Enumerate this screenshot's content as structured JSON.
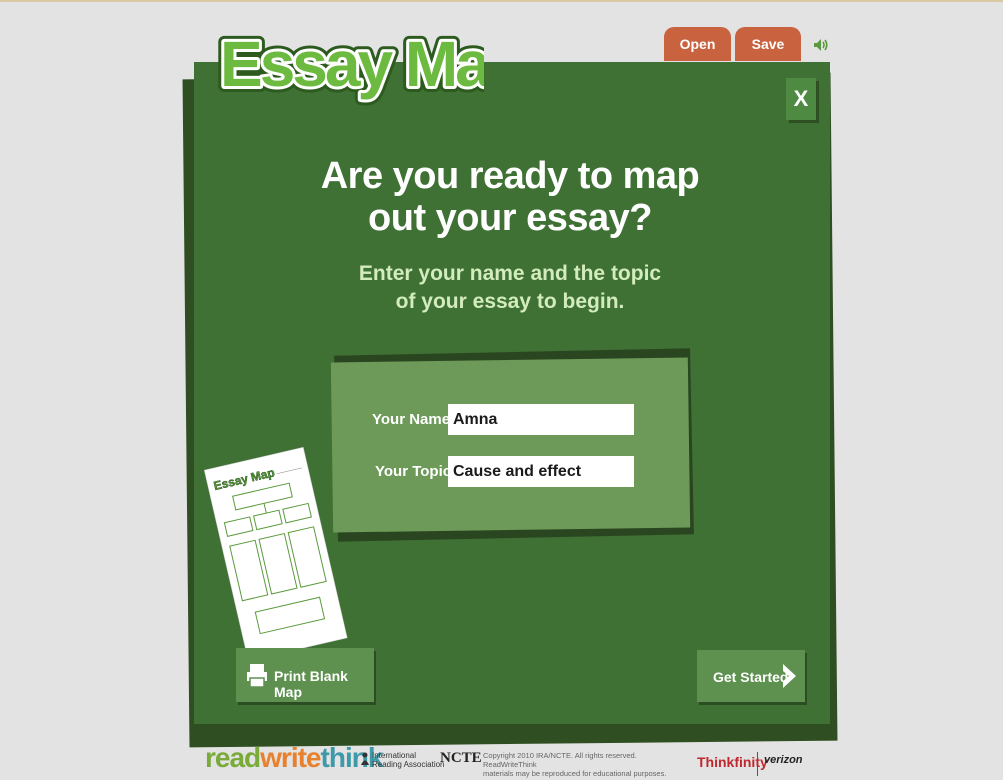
{
  "app": {
    "logo_text": "Essay Map",
    "open_label": "Open",
    "save_label": "Save",
    "close_label": "X"
  },
  "intro": {
    "headline_line1": "Are you ready to map",
    "headline_line2": "out your essay?",
    "sub_line1": "Enter your name and the topic",
    "sub_line2": "of your essay to begin."
  },
  "form": {
    "name_label": "Your Name:",
    "name_value": "Amna",
    "topic_label": "Your Topic:",
    "topic_value": "Cause and effect"
  },
  "actions": {
    "print_label": "Print Blank Map",
    "start_label": "Get Started"
  },
  "footer": {
    "brand_read": "read",
    "brand_write": "write",
    "brand_think": "think",
    "ira_line1": "International",
    "ira_line2": "Reading Association",
    "ncte": "NCTE",
    "copyright_line1": "Copyright 2010 IRA/NCTE. All rights reserved. ReadWriteThink",
    "copyright_line2": "materials may be reproduced for educational purposes.",
    "thinkfinity": "Thinkfinity",
    "verizon": "verizon"
  },
  "colors": {
    "board": "#3f7034",
    "panel": "#6d9a58",
    "tab": "#c8623f",
    "subtext": "#d3ecbd"
  },
  "icons": [
    "speaker-icon",
    "printer-icon",
    "arrow-right-icon",
    "essay-map-logo"
  ]
}
